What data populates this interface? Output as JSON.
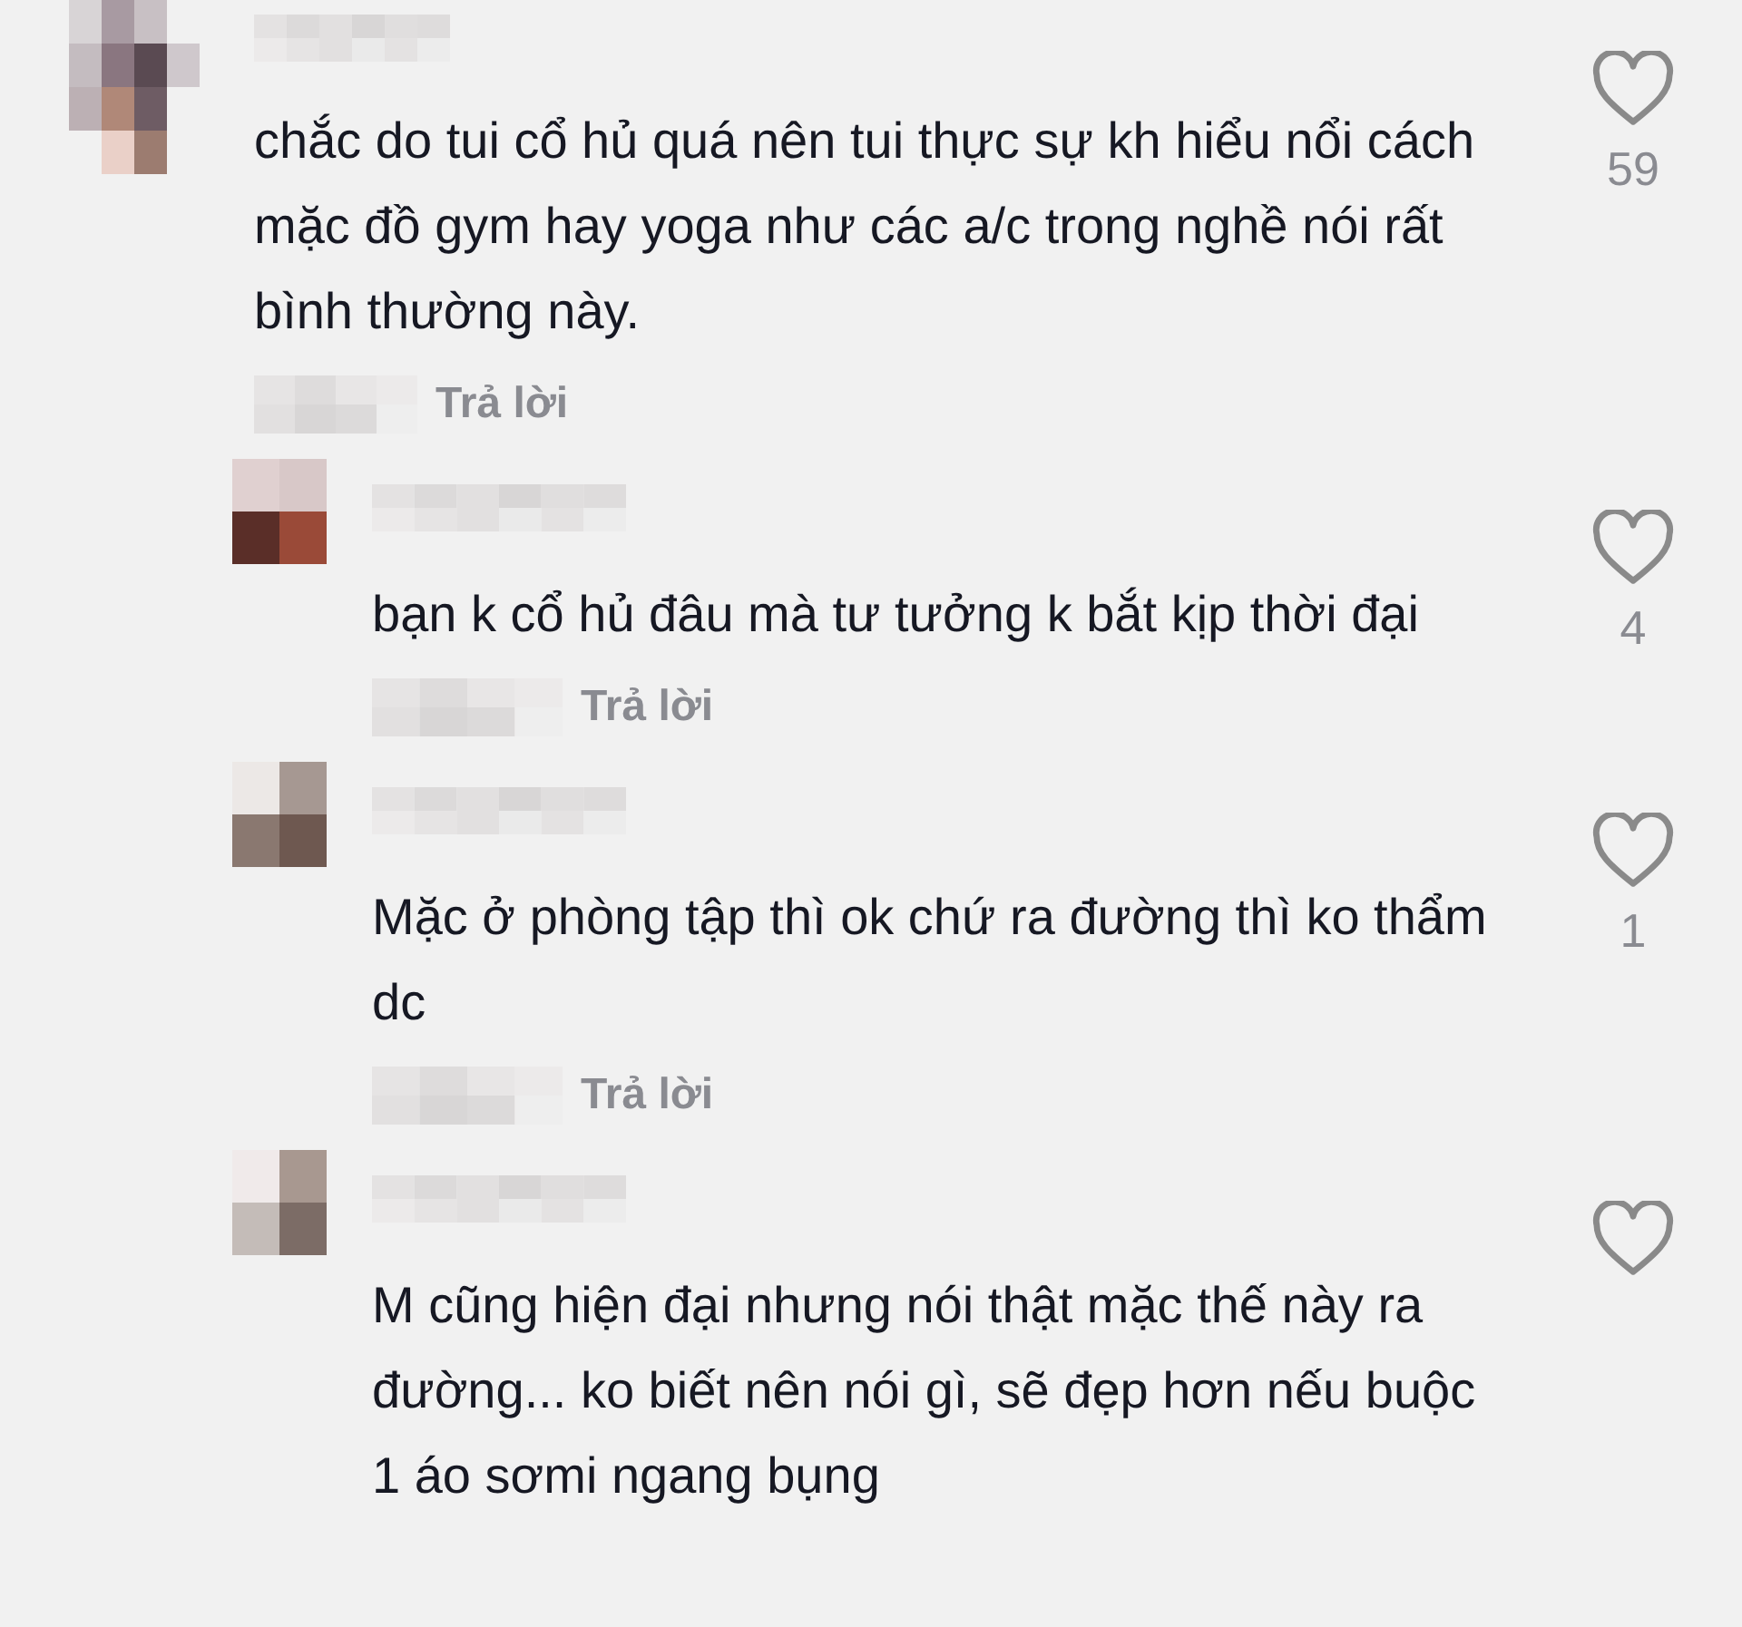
{
  "comments": [
    {
      "text": "chắc do tui cổ hủ quá nên tui thực sự kh hiểu nổi cách mặc đồ gym hay yoga như các a/c trong nghề nói rất bình thường này.",
      "reply_label": "Trả lời",
      "likes": "59",
      "liked": false,
      "replies": [
        {
          "text": "bạn k cổ hủ đâu mà tư tưởng k bắt kịp thời đại",
          "reply_label": "Trả lời",
          "likes": "4",
          "liked": false
        },
        {
          "text": "Mặc ở phòng tập thì ok chứ ra đường thì ko thẩm dc",
          "reply_label": "Trả lời",
          "likes": "1",
          "liked": false
        },
        {
          "text": "M cũng hiện đại nhưng nói thật mặc thế này ra đường... ko biết nên nói gì, sẽ đẹp hơn nếu buộc 1 áo sơmi ngang bụng",
          "liked": false
        }
      ]
    }
  ]
}
